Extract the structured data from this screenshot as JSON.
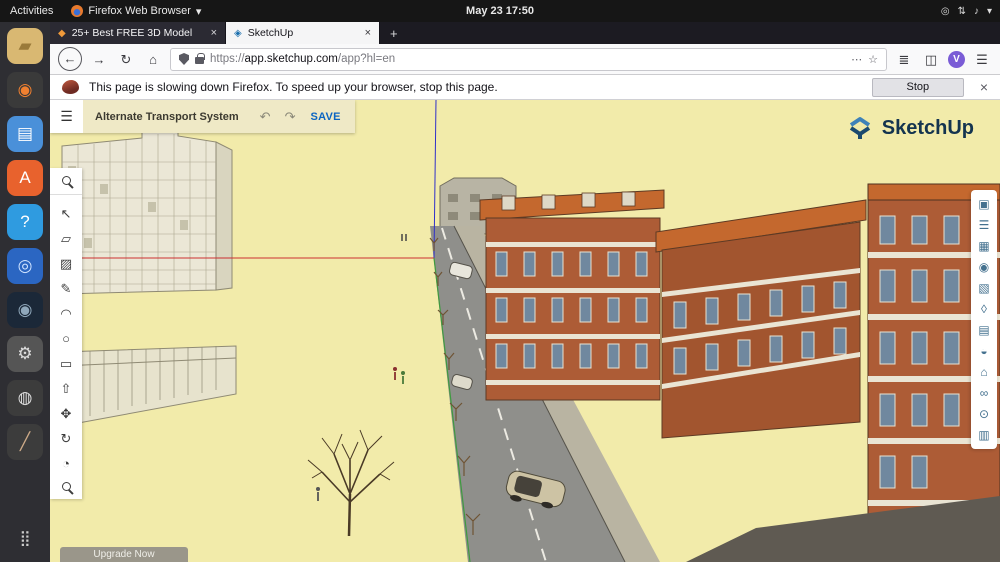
{
  "colors": {
    "ground": "#f2ebaa",
    "brick": "#ad5c36",
    "brick-dark": "#a2552f",
    "roof": "#c4682e",
    "road": "#8f8f8b",
    "accent-blue": "#0b65c2",
    "favicon-orange": "#f09a3a",
    "sketchup-blue": "#1a6fae"
  },
  "gnome": {
    "activities_label": "Activities",
    "app_menu_label": "Firefox Web Browser",
    "app_menu_caret": "▾",
    "clock": "May 23 17:50",
    "tray": [
      {
        "name": "screencast",
        "glyph": "◎"
      },
      {
        "name": "network",
        "glyph": "⇅"
      },
      {
        "name": "volume",
        "glyph": "♪"
      },
      {
        "name": "menu-caret",
        "glyph": "▾"
      }
    ]
  },
  "dock": {
    "items": [
      {
        "name": "files",
        "glyph": "▰",
        "bg": "#d9b872",
        "fg": "#9a7a3a"
      },
      {
        "name": "rhythmbox",
        "glyph": "◉",
        "bg": "#3a3a3a",
        "fg": "#f08030"
      },
      {
        "name": "document-viewer",
        "glyph": "▤",
        "bg": "#4a90d9",
        "fg": "#ffffff"
      },
      {
        "name": "ubuntu-software",
        "glyph": "A",
        "bg": "#e8622d",
        "fg": "#ffffff"
      },
      {
        "name": "help",
        "glyph": "?",
        "bg": "#2f9be0",
        "fg": "#ffffff"
      },
      {
        "name": "browser",
        "glyph": "◎",
        "bg": "#2b66c2",
        "fg": "#cfe3ff"
      },
      {
        "name": "steam",
        "glyph": "◉",
        "bg": "#1b2838",
        "fg": "#90a8bb"
      },
      {
        "name": "settings",
        "glyph": "⚙",
        "bg": "#555555",
        "fg": "#dddddd"
      },
      {
        "name": "color-utility",
        "glyph": "◍",
        "bg": "#3c3c3c",
        "fg": "#dddddd"
      },
      {
        "name": "ruler",
        "glyph": "╱",
        "bg": "#3c3c3c",
        "fg": "#ccaa88"
      },
      {
        "name": "show-applications",
        "glyph": "⣿",
        "bg": "transparent",
        "fg": "#cccccc"
      }
    ]
  },
  "firefox": {
    "close_glyph": "×",
    "new_tab_glyph": "+",
    "tabs": [
      {
        "label": "25+ Best FREE 3D Model",
        "favicon": "◆",
        "active": false
      },
      {
        "label": "SketchUp",
        "favicon": "◈",
        "active": true
      }
    ],
    "nav": {
      "back_icon": "←",
      "forward_icon": "→",
      "reload_icon": "↻",
      "home_icon": "⌂",
      "url_scheme": "https://",
      "url_host": "app.sketchup.com",
      "url_path": "/app?hl=en",
      "overflow_icon": "⋯",
      "star_icon": "☆",
      "library_icon": "≣",
      "sidebar_icon": "◫",
      "account_icon": "V",
      "menu_icon": "☰"
    },
    "notification": {
      "message": "This page is slowing down Firefox. To speed up your browser, stop this page.",
      "stop_label": "Stop"
    }
  },
  "sketchup": {
    "header": {
      "menu_icon": "☰",
      "title": "Alternate Transport System",
      "undo_icon": "↶",
      "redo_icon": "↷",
      "save_label": "SAVE"
    },
    "brand": "SketchUp",
    "upgrade_label": "Upgrade Now",
    "left_tools": [
      {
        "name": "search",
        "glyph": "magnifier"
      },
      {
        "name": "select",
        "glyph": "↖"
      },
      {
        "name": "eraser",
        "glyph": "▱"
      },
      {
        "name": "paint",
        "glyph": "▨"
      },
      {
        "name": "line",
        "glyph": "✎"
      },
      {
        "name": "arc",
        "glyph": "◠"
      },
      {
        "name": "circle",
        "glyph": "○"
      },
      {
        "name": "shapes",
        "glyph": "▭"
      },
      {
        "name": "push-pull",
        "glyph": "⇧"
      },
      {
        "name": "move",
        "glyph": "✥"
      },
      {
        "name": "rotate",
        "glyph": "↻"
      },
      {
        "name": "tape-measure",
        "glyph": "◔"
      },
      {
        "name": "zoom",
        "glyph": "magnifier"
      }
    ],
    "right_panels": [
      {
        "name": "entity-info",
        "glyph": "▣"
      },
      {
        "name": "instructor",
        "glyph": "☰"
      },
      {
        "name": "components",
        "glyph": "▦"
      },
      {
        "name": "materials",
        "glyph": "◉"
      },
      {
        "name": "styles",
        "glyph": "▧"
      },
      {
        "name": "tags",
        "glyph": "◊"
      },
      {
        "name": "scenes",
        "glyph": "▤"
      },
      {
        "name": "display",
        "glyph": "◒"
      },
      {
        "name": "views",
        "glyph": "⌂"
      },
      {
        "name": "soften-edges",
        "glyph": "∞"
      },
      {
        "name": "add-location",
        "glyph": "⊙"
      },
      {
        "name": "model-info",
        "glyph": "▥"
      }
    ]
  }
}
